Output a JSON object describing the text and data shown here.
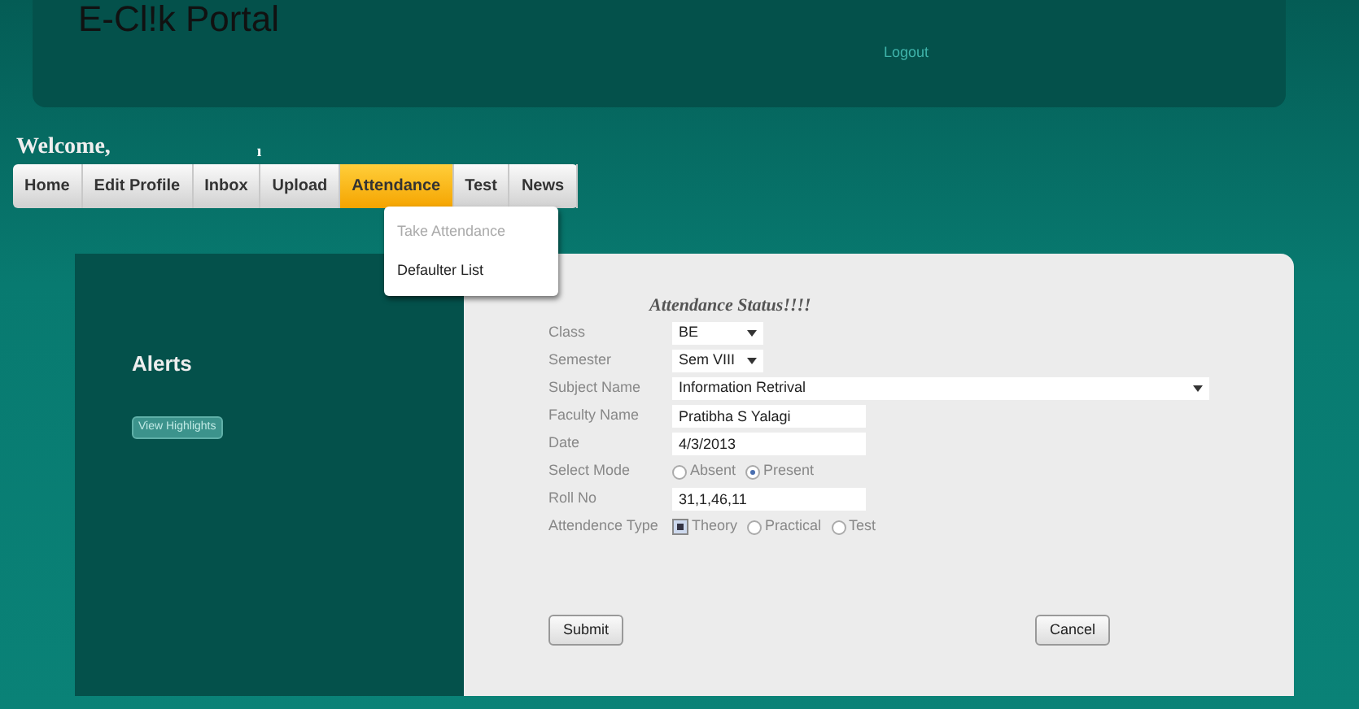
{
  "header": {
    "title": "E-Cl!k Portal",
    "logout": "Logout"
  },
  "welcome": "Welcome,",
  "welcome_mark": "ı",
  "menu": [
    {
      "label": "Home",
      "selected": false
    },
    {
      "label": "Edit Profile",
      "selected": false
    },
    {
      "label": "Inbox",
      "selected": false
    },
    {
      "label": "Upload",
      "selected": false
    },
    {
      "label": "Attendance",
      "selected": true
    },
    {
      "label": "Test",
      "selected": false
    },
    {
      "label": "News",
      "selected": false
    }
  ],
  "dropdown": [
    {
      "label": "Take Attendance",
      "disabled": true
    },
    {
      "label": "Defaulter List",
      "disabled": false
    }
  ],
  "alerts": {
    "title": "Alerts",
    "button": "View Highlights"
  },
  "form": {
    "heading": "Attendance Status!!!!",
    "fields": [
      {
        "label": "Class",
        "kind": "select",
        "value": "BE",
        "wide": false
      },
      {
        "label": "Semester",
        "kind": "select",
        "value": "Sem VIII",
        "wide": false
      },
      {
        "label": "Subject Name",
        "kind": "select",
        "value": "Information Retrival",
        "wide": true
      },
      {
        "label": "Faculty Name",
        "kind": "text",
        "value": "Pratibha S Yalagi"
      },
      {
        "label": "Date",
        "kind": "text",
        "value": "4/3/2013"
      },
      {
        "label": "Select Mode",
        "kind": "choices",
        "options": [
          {
            "label": "Absent",
            "kind": "radio",
            "selected": false
          },
          {
            "label": "Present",
            "kind": "radio",
            "selected": true
          }
        ]
      },
      {
        "label": "Roll No",
        "kind": "text",
        "value": "31,1,46,11"
      },
      {
        "label": "Attendence Type",
        "kind": "choices",
        "options": [
          {
            "label": "Theory",
            "kind": "checkbox",
            "selected": true
          },
          {
            "label": "Practical",
            "kind": "radio",
            "selected": false
          },
          {
            "label": "Test",
            "kind": "radio",
            "selected": false
          }
        ]
      }
    ],
    "buttons": [
      "Submit",
      "Cancel"
    ]
  }
}
